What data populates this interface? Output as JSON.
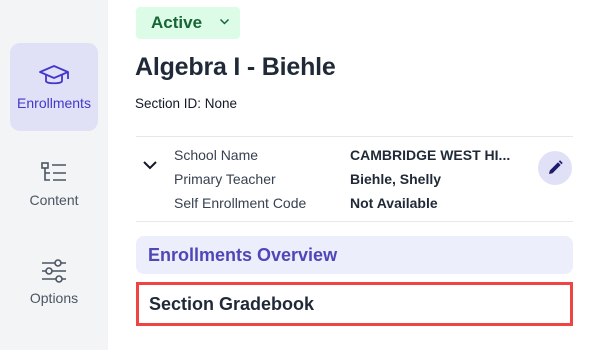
{
  "sidebar": {
    "items": [
      {
        "label": "Enrollments",
        "icon": "graduation-cap-icon",
        "active": true
      },
      {
        "label": "Content",
        "icon": "tree-list-icon",
        "active": false
      },
      {
        "label": "Options",
        "icon": "sliders-icon",
        "active": false
      }
    ]
  },
  "header": {
    "status": "Active",
    "title": "Algebra I - Biehle",
    "section_id": "Section ID: None"
  },
  "details": [
    {
      "label": "School Name",
      "value": "CAMBRIDGE WEST HI..."
    },
    {
      "label": "Primary Teacher",
      "value": "Biehle, Shelly"
    },
    {
      "label": "Self Enrollment Code",
      "value": "Not Available"
    }
  ],
  "links": {
    "overview": "Enrollments Overview",
    "gradebook": "Section Gradebook"
  },
  "colors": {
    "accent": "#4f46b8",
    "status_bg": "#dcfce7",
    "status_text": "#166534",
    "highlight_border": "#ef4444"
  }
}
